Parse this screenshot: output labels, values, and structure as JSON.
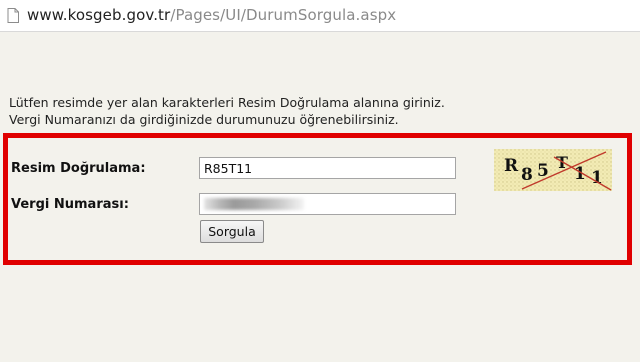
{
  "browser": {
    "url_domain": "www.kosgeb.gov.tr",
    "url_path": "/Pages/UI/DurumSorgula.aspx"
  },
  "instructions": {
    "line1": "Lütfen resimde yer alan karakterleri Resim Doğrulama alanına giriniz.",
    "line2": "Vergi Numaranızı da girdiğinizde durumunuzu öğrenebilirsiniz."
  },
  "form": {
    "captcha_label": "Resim Doğrulama:",
    "captcha_value": "R85T11",
    "vergi_label": "Vergi Numarası:",
    "vergi_value": "",
    "submit_label": "Sorgula",
    "captcha_image_text": [
      "R",
      "8",
      "5",
      "T",
      "1",
      "1"
    ]
  },
  "colors": {
    "highlight": "#e00000",
    "background": "#f3f2ec",
    "captcha_background": "#f2ebb4"
  }
}
